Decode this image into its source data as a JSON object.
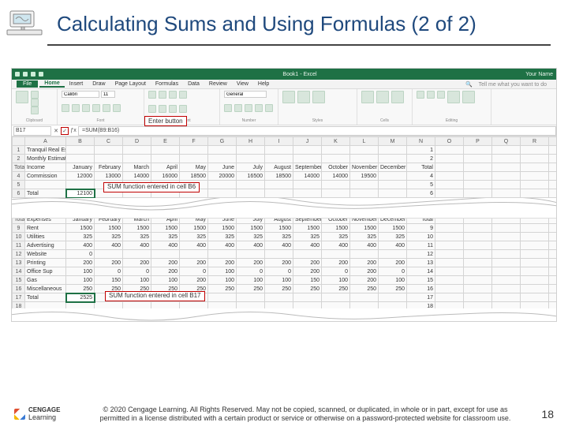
{
  "slide": {
    "title": "Calculating Sums and Using Formulas (2 of 2)",
    "page_number": "18"
  },
  "footer": {
    "brand_top": "CENGAGE",
    "brand_bottom": "Learning",
    "copyright": "© 2020 Cengage Learning. All Rights Reserved. May not be copied, scanned, or duplicated, in whole or in part, except for use as permitted in a license distributed with a certain product or service or otherwise on a password-protected website for classroom use."
  },
  "excel": {
    "window_center": "Book1 - Excel",
    "user_label": "Your Name",
    "tabs": {
      "file": "File",
      "home": "Home",
      "insert": "Insert",
      "draw": "Draw",
      "page_layout": "Page Layout",
      "formulas": "Formulas",
      "data": "Data",
      "review": "Review",
      "view": "View",
      "help": "Help",
      "tell_me": "Tell me what you want to do"
    },
    "ribbon": {
      "font_name": "Calibri",
      "font_size": "11",
      "number_format": "General",
      "groups": {
        "clipboard": "Clipboard",
        "font": "Font",
        "alignment": "Alignment",
        "number": "Number",
        "styles": "Styles",
        "cells": "Cells",
        "editing": "Editing"
      }
    },
    "callouts": {
      "enter_button": "Enter button",
      "sum_b6": "SUM function entered in cell B6",
      "sum_b17": "SUM function entered in cell B17"
    },
    "namebox": "B17",
    "formula": "=SUM(B9:B16)",
    "columns": [
      "",
      "A",
      "B",
      "C",
      "D",
      "E",
      "F",
      "G",
      "H",
      "I",
      "J",
      "K",
      "L",
      "M",
      "N",
      "O",
      "P",
      "Q",
      "R",
      "S"
    ],
    "rows_top": [
      {
        "n": "1",
        "a": "Tranquil Real Estate Budget"
      },
      {
        "n": "2",
        "a": "Monthly Estimates"
      },
      {
        "n": "Total",
        "a": "Income",
        "b": "January",
        "c": "February",
        "d": "March",
        "e": "April",
        "f": "May",
        "g": "June",
        "h": "July",
        "i": "August",
        "j": "September",
        "k": "October",
        "l": "November",
        "m": "December"
      },
      {
        "n": "4",
        "a": "Commission",
        "b": "12000",
        "c": "13000",
        "d": "14000",
        "e": "16000",
        "f": "18500",
        "g": "20000",
        "h": "16500",
        "i": "18500",
        "j": "14000",
        "k": "14000",
        "l": "19500",
        "m": ""
      },
      {
        "n": "5",
        "a": "",
        "b": ""
      },
      {
        "n": "6",
        "a": "Total",
        "b": "12100"
      }
    ],
    "rows_bottom": [
      {
        "n": "Total",
        "a": "Expenses",
        "b": "January",
        "c": "February",
        "d": "March",
        "e": "April",
        "f": "May",
        "g": "June",
        "h": "July",
        "i": "August",
        "j": "September",
        "k": "October",
        "l": "November",
        "m": "December"
      },
      {
        "n": "9",
        "a": "Rent",
        "b": "1500",
        "c": "1500",
        "d": "1500",
        "e": "1500",
        "f": "1500",
        "g": "1500",
        "h": "1500",
        "i": "1500",
        "j": "1500",
        "k": "1500",
        "l": "1500",
        "m": "1500"
      },
      {
        "n": "10",
        "a": "Utilities",
        "b": "325",
        "c": "325",
        "d": "325",
        "e": "325",
        "f": "325",
        "g": "325",
        "h": "325",
        "i": "325",
        "j": "325",
        "k": "325",
        "l": "325",
        "m": "325"
      },
      {
        "n": "11",
        "a": "Advertising",
        "b": "400",
        "c": "400",
        "d": "400",
        "e": "400",
        "f": "400",
        "g": "400",
        "h": "400",
        "i": "400",
        "j": "400",
        "k": "400",
        "l": "400",
        "m": "400"
      },
      {
        "n": "12",
        "a": "Website",
        "b": "0"
      },
      {
        "n": "13",
        "a": "Printing",
        "b": "200",
        "c": "200",
        "d": "200",
        "e": "200",
        "f": "200",
        "g": "200",
        "h": "200",
        "i": "200",
        "j": "200",
        "k": "200",
        "l": "200",
        "m": "200"
      },
      {
        "n": "14",
        "a": "Office Sup",
        "b": "100",
        "c": "0",
        "d": "0",
        "e": "200",
        "f": "0",
        "g": "100",
        "h": "0",
        "i": "0",
        "j": "200",
        "k": "0",
        "l": "200",
        "m": "0"
      },
      {
        "n": "15",
        "a": "Gas",
        "b": "100",
        "c": "150",
        "d": "100",
        "e": "100",
        "f": "200",
        "g": "100",
        "h": "100",
        "i": "100",
        "j": "150",
        "k": "100",
        "l": "200",
        "m": "100"
      },
      {
        "n": "16",
        "a": "Miscellaneous",
        "b": "250",
        "c": "250",
        "d": "250",
        "e": "250",
        "f": "250",
        "g": "250",
        "h": "250",
        "i": "250",
        "j": "250",
        "k": "250",
        "l": "250",
        "m": "250"
      },
      {
        "n": "17",
        "a": "Total",
        "b": "2525"
      },
      {
        "n": "18",
        "a": ""
      }
    ]
  }
}
